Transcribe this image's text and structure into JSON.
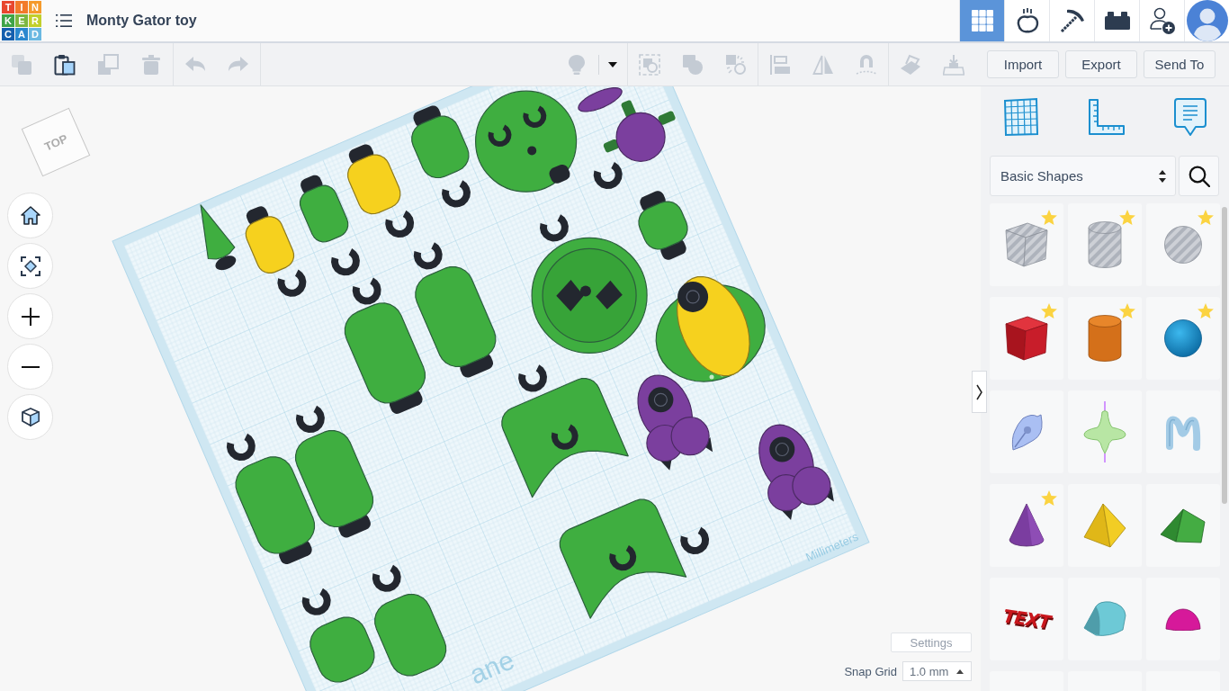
{
  "header": {
    "logo": [
      {
        "letter": "T",
        "color": "#e8472e"
      },
      {
        "letter": "I",
        "color": "#f27a2a"
      },
      {
        "letter": "N",
        "color": "#f59a2c"
      },
      {
        "letter": "K",
        "color": "#3fa447"
      },
      {
        "letter": "E",
        "color": "#7cb740"
      },
      {
        "letter": "R",
        "color": "#c2cf2b"
      },
      {
        "letter": "C",
        "color": "#155fae"
      },
      {
        "letter": "A",
        "color": "#2a88cf"
      },
      {
        "letter": "D",
        "color": "#6ab8e2"
      }
    ],
    "title": "Monty Gator toy",
    "nav": [
      {
        "kind": "grid",
        "selected": true
      },
      {
        "kind": "apple",
        "selected": false
      },
      {
        "kind": "pickaxe",
        "selected": false
      },
      {
        "kind": "bricks",
        "selected": false
      },
      {
        "kind": "invite",
        "selected": false
      },
      {
        "kind": "avatar",
        "selected": false
      }
    ]
  },
  "toolbar": {
    "left_groups": [
      [
        {
          "kind": "copy",
          "disabled": true
        },
        {
          "kind": "paste",
          "disabled": false
        },
        {
          "kind": "duplicate",
          "disabled": true
        },
        {
          "kind": "delete",
          "disabled": true
        }
      ],
      [
        {
          "kind": "undo",
          "disabled": true
        },
        {
          "kind": "redo",
          "disabled": true
        }
      ]
    ],
    "right_groups": [
      [
        {
          "kind": "light",
          "disabled": true
        },
        {
          "kind": "caret",
          "disabled": false
        }
      ],
      [
        {
          "kind": "frame",
          "disabled": true
        },
        {
          "kind": "group",
          "disabled": true
        },
        {
          "kind": "ungroup",
          "disabled": true
        }
      ],
      [
        {
          "kind": "align",
          "disabled": true
        },
        {
          "kind": "mirror",
          "disabled": true
        },
        {
          "kind": "magnet",
          "disabled": true
        }
      ],
      [
        {
          "kind": "plane",
          "disabled": true
        },
        {
          "kind": "drop",
          "disabled": true
        }
      ]
    ],
    "buttons": [
      "Import",
      "Export",
      "Send To"
    ]
  },
  "view_cube": {
    "label": "TOP"
  },
  "workplane": {
    "unit": "Millimeters",
    "name": "ane"
  },
  "canvas_footer": {
    "settings": "Settings",
    "snap_label": "Snap Grid",
    "snap_value": "1.0 mm"
  },
  "panel": {
    "category": "Basic Shapes",
    "shapes": [
      {
        "kind": "box-hole",
        "starred": true
      },
      {
        "kind": "cylinder-hole",
        "starred": true
      },
      {
        "kind": "sphere-hole",
        "starred": true
      },
      {
        "kind": "box",
        "starred": true
      },
      {
        "kind": "cylinder",
        "starred": true
      },
      {
        "kind": "sphere",
        "starred": true
      },
      {
        "kind": "scribble",
        "starred": false
      },
      {
        "kind": "revolver",
        "starred": false
      },
      {
        "kind": "extrusion",
        "starred": false
      },
      {
        "kind": "cone",
        "starred": true
      },
      {
        "kind": "pyramid",
        "starred": false
      },
      {
        "kind": "roof",
        "starred": false
      },
      {
        "kind": "text",
        "label": "TEXT",
        "starred": false
      },
      {
        "kind": "roundroof",
        "starred": false
      },
      {
        "kind": "halfsphere",
        "starred": false
      },
      {
        "kind": "blank",
        "starred": false
      },
      {
        "kind": "blank",
        "starred": false
      },
      {
        "kind": "blank",
        "starred": false
      }
    ]
  }
}
